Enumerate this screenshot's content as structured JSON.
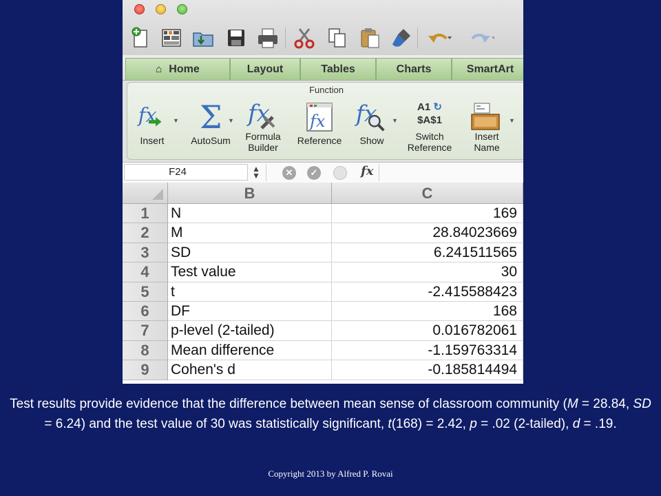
{
  "window": {
    "traffic_lights": [
      "close",
      "minimize",
      "zoom"
    ]
  },
  "toolbar": {
    "icons": [
      "new-icon",
      "templates-icon",
      "open-icon",
      "save-icon",
      "print-icon",
      "cut-icon",
      "copy-icon",
      "paste-icon",
      "format-painter-icon",
      "undo-icon",
      "redo-icon"
    ]
  },
  "ribbon": {
    "tabs": [
      {
        "label": "Home"
      },
      {
        "label": "Layout"
      },
      {
        "label": "Tables"
      },
      {
        "label": "Charts"
      },
      {
        "label": "SmartArt"
      }
    ],
    "group_title": "Function",
    "buttons": [
      {
        "label": "Insert",
        "icon": "insert-function-icon"
      },
      {
        "label": "AutoSum",
        "icon": "autosum-icon"
      },
      {
        "label_line1": "Formula",
        "label_line2": "Builder",
        "icon": "formula-builder-icon"
      },
      {
        "label": "Reference",
        "icon": "reference-icon"
      },
      {
        "label": "Show",
        "icon": "show-formulas-icon"
      },
      {
        "label_line1": "Switch",
        "label_line2": "Reference",
        "icon_text_1": "A1",
        "icon_text_2": "$A$1"
      },
      {
        "label_line1": "Insert",
        "label_line2": "Name",
        "icon": "insert-name-icon"
      }
    ]
  },
  "formula_bar": {
    "name_box": "F24",
    "fx_label": "fx",
    "formula": ""
  },
  "sheet": {
    "column_headers": [
      "B",
      "C"
    ],
    "rows": [
      {
        "num": "1",
        "b": "N",
        "c": "169"
      },
      {
        "num": "2",
        "b": "M",
        "c": "28.84023669"
      },
      {
        "num": "3",
        "b": "SD",
        "c": "6.241511565"
      },
      {
        "num": "4",
        "b": "Test value",
        "c": "30"
      },
      {
        "num": "5",
        "b": "t",
        "c": "-2.415588423"
      },
      {
        "num": "6",
        "b": "DF",
        "c": "168"
      },
      {
        "num": "7",
        "b": "p-level (2-tailed)",
        "c": "0.016782061"
      },
      {
        "num": "8",
        "b": "Mean difference",
        "c": "-1.159763314"
      },
      {
        "num": "9",
        "b": "Cohen's d",
        "c": "-0.185814494"
      }
    ]
  },
  "caption": {
    "p1": "Test results provide evidence that the difference between mean sense of classroom community (",
    "M": "M",
    "p2": " = 28.84, ",
    "SD": "SD",
    "p3": " = 6.24)  and the test value of 30 was  statistically significant, ",
    "t": "t",
    "p4": "(168) = 2.42, ",
    "p": "p",
    "p5": " = .02 (2-tailed), ",
    "d": "d",
    "p6": " = .19."
  },
  "copyright": "Copyright 2013 by Alfred P. Rovai",
  "colors": {
    "background": "#0f1d66",
    "ribbon_tab": "#b9d6a4",
    "text_on_background": "#ffffff"
  }
}
